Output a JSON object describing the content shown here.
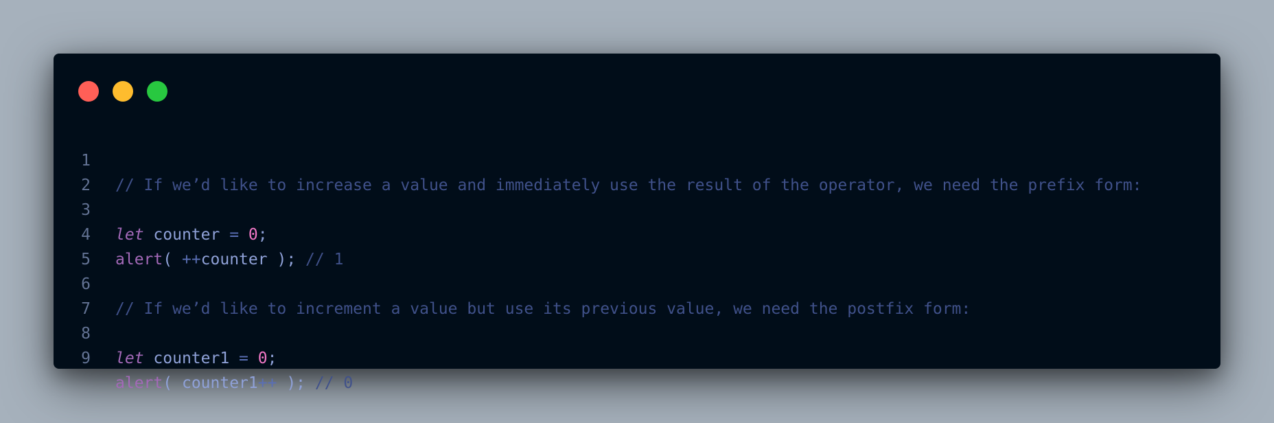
{
  "colors": {
    "background": "#a6b1bc",
    "window": "#010d19",
    "close": "#ff5f57",
    "minimize": "#febc2e",
    "maximize": "#28c840"
  },
  "code": {
    "line_numbers": [
      "1",
      "2",
      "3",
      "4",
      "5",
      "6",
      "7",
      "8",
      "9"
    ],
    "lines": [
      [
        {
          "type": "comment",
          "text": "// If we’d like to increase a value and immediately use the result of the operator, we need the prefix form:"
        }
      ],
      [],
      [
        {
          "type": "keyword",
          "text": "let"
        },
        {
          "type": "space",
          "text": " "
        },
        {
          "type": "ident",
          "text": "counter"
        },
        {
          "type": "space",
          "text": " "
        },
        {
          "type": "op",
          "text": "="
        },
        {
          "type": "space",
          "text": " "
        },
        {
          "type": "num",
          "text": "0"
        },
        {
          "type": "punct",
          "text": ";"
        }
      ],
      [
        {
          "type": "func",
          "text": "alert"
        },
        {
          "type": "paren",
          "text": "("
        },
        {
          "type": "space",
          "text": " "
        },
        {
          "type": "op",
          "text": "++"
        },
        {
          "type": "ident",
          "text": "counter"
        },
        {
          "type": "space",
          "text": " "
        },
        {
          "type": "paren",
          "text": ")"
        },
        {
          "type": "punct",
          "text": ";"
        },
        {
          "type": "space",
          "text": " "
        },
        {
          "type": "comment",
          "text": "// 1"
        }
      ],
      [],
      [
        {
          "type": "comment",
          "text": "// If we’d like to increment a value but use its previous value, we need the postfix form:"
        }
      ],
      [],
      [
        {
          "type": "keyword",
          "text": "let"
        },
        {
          "type": "space",
          "text": " "
        },
        {
          "type": "ident",
          "text": "counter1"
        },
        {
          "type": "space",
          "text": " "
        },
        {
          "type": "op",
          "text": "="
        },
        {
          "type": "space",
          "text": " "
        },
        {
          "type": "num",
          "text": "0"
        },
        {
          "type": "punct",
          "text": ";"
        }
      ],
      [
        {
          "type": "func",
          "text": "alert"
        },
        {
          "type": "paren",
          "text": "("
        },
        {
          "type": "space",
          "text": " "
        },
        {
          "type": "ident",
          "text": "counter1"
        },
        {
          "type": "op",
          "text": "++"
        },
        {
          "type": "space",
          "text": " "
        },
        {
          "type": "paren",
          "text": ")"
        },
        {
          "type": "punct",
          "text": ";"
        },
        {
          "type": "space",
          "text": " "
        },
        {
          "type": "comment",
          "text": "// 0"
        }
      ]
    ]
  }
}
